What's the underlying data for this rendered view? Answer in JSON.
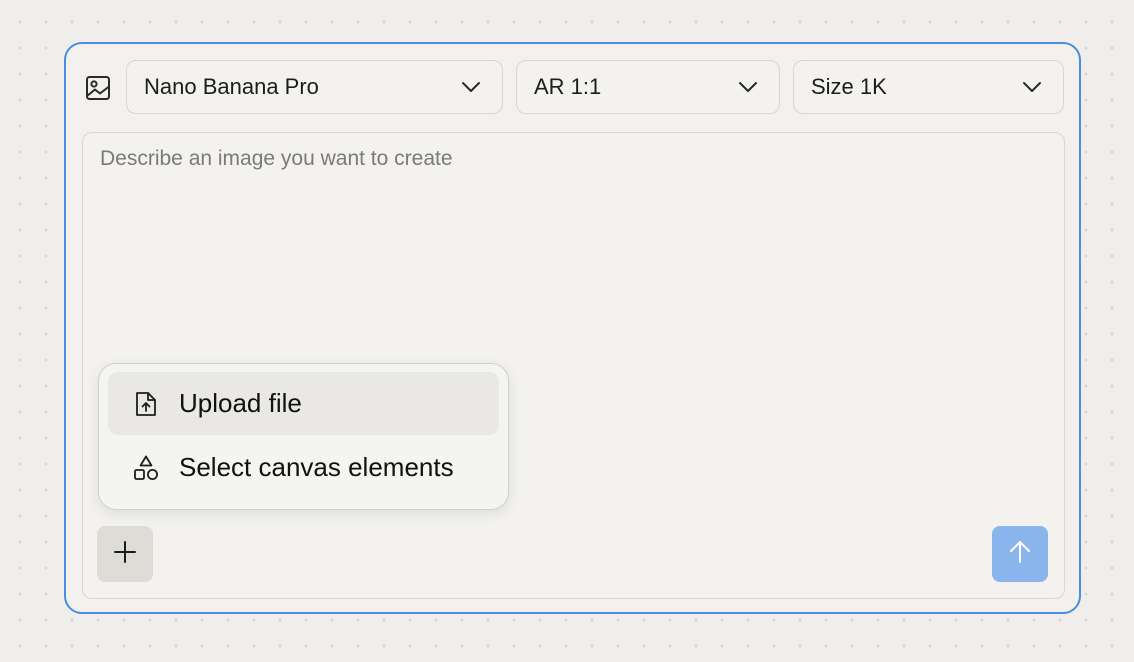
{
  "colors": {
    "panel_border": "#4a8ee0",
    "send_button": "#8ab5ec",
    "plus_button": "#dedcd7",
    "menu_active": "#e9e8e5"
  },
  "toolbar": {
    "mode_icon": "image-icon",
    "model": {
      "label": "Nano Banana Pro",
      "icon": "chevron-down-icon"
    },
    "aspect_ratio": {
      "label": "AR 1:1",
      "icon": "chevron-down-icon"
    },
    "size": {
      "label": "Size 1K",
      "icon": "chevron-down-icon"
    }
  },
  "prompt": {
    "value": "",
    "placeholder": "Describe an image you want to create"
  },
  "attach_menu": {
    "items": [
      {
        "label": "Upload file",
        "icon": "file-upload-icon",
        "highlighted": true
      },
      {
        "label": "Select canvas elements",
        "icon": "shapes-icon",
        "highlighted": false
      }
    ]
  },
  "actions": {
    "add_icon": "plus-icon",
    "send_icon": "arrow-up-icon"
  }
}
